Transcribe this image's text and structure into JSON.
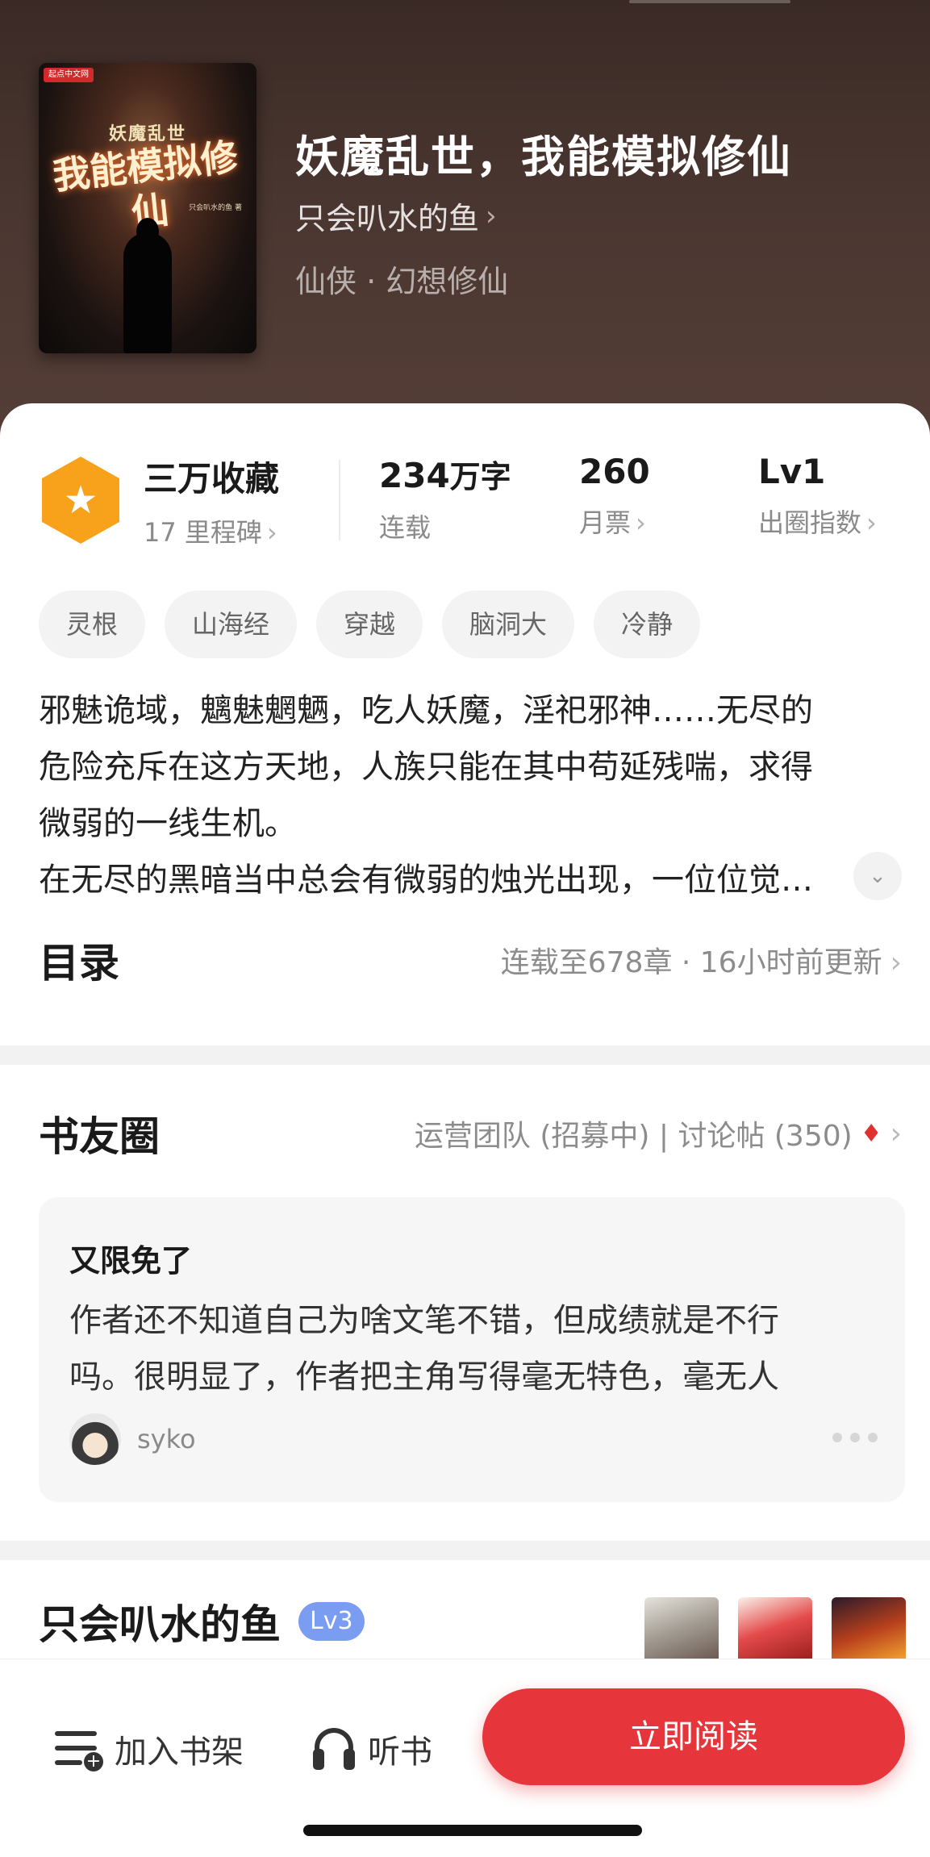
{
  "book": {
    "title": "妖魔乱世，我能模拟修仙",
    "author": "只会叭水的鱼",
    "genre": "仙侠 · 幻想修仙",
    "cover": {
      "title": "妖魔乱世",
      "calligraphy": "我能模拟修仙",
      "author_small": "只会叭水的鱼 著",
      "publisher_badge": "起点中文网"
    }
  },
  "stats": {
    "collect": {
      "main": "三万收藏",
      "sub": "17 里程碑"
    },
    "words": {
      "number": "234",
      "unit": "万字",
      "sub": "连载"
    },
    "ticket": {
      "main": "260",
      "sub": "月票"
    },
    "level": {
      "main": "Lv1",
      "sub": "出圈指数"
    }
  },
  "tags": [
    "灵根",
    "山海经",
    "穿越",
    "脑洞大",
    "冷静"
  ],
  "synopsis": [
    "邪魅诡域，魑魅魍魉，吃人妖魔，淫祀邪神……无尽的",
    "危险充斥在这方天地，人族只能在其中苟延残喘，求得",
    "微弱的一线生机。",
    "在无尽的黑暗当中总会有微弱的烛光出现，一位位觉…"
  ],
  "toc": {
    "title": "目录",
    "status": "连载至678章 · 16小时前更新"
  },
  "circle": {
    "title": "书友圈",
    "meta": "运营团队 (招募中) | 讨论帖 (350)",
    "post": {
      "title": "又限免了",
      "body": [
        "作者还不知道自己为啥文笔不错，但成绩就是不行",
        "吗。很明显了，作者把主角写得毫无特色，毫无人"
      ],
      "user": "syko"
    }
  },
  "author_section": {
    "name": "只会叭水的鱼",
    "level": "Lv3"
  },
  "bottom_bar": {
    "add_shelf": "加入书架",
    "listen": "听书",
    "read_now": "立即阅读"
  },
  "icons": {
    "star": "star-icon",
    "chevron": "chevron-right-icon",
    "fire": "fire-icon",
    "shelf": "bookshelf-add-icon",
    "headphones": "headphones-icon"
  },
  "colors": {
    "accent": "#e7353c",
    "badge": "#f7a21a",
    "level_badge": "#7a9df2"
  }
}
